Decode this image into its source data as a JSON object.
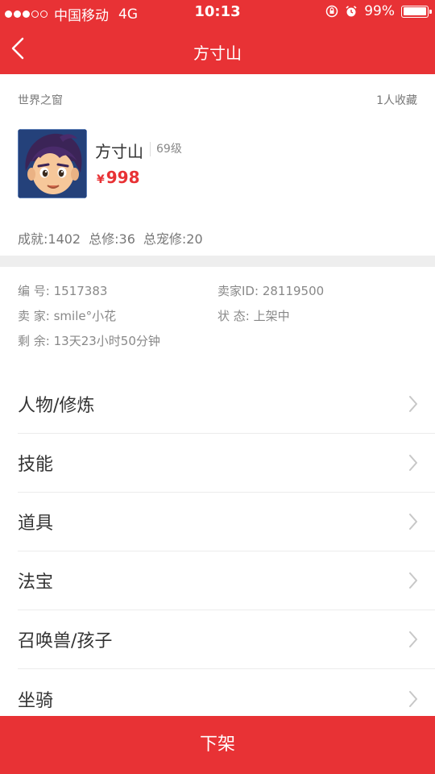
{
  "status_bar": {
    "carrier": "中国移动",
    "network": "4G",
    "time": "10:13",
    "battery": "99%",
    "battery_level": 0.99
  },
  "nav": {
    "title": "方寸山",
    "back_icon": "chevron-left-icon"
  },
  "role": {
    "server": "世界之窗",
    "favorites": "1人收藏",
    "name": "方寸山",
    "level": "69级",
    "price_symbol": "¥",
    "price": "998",
    "stats": [
      "成就:1402",
      "总修:36",
      "总宠修:20"
    ]
  },
  "details": {
    "id_label": "编  号:",
    "id_value": "1517383",
    "seller_id_label": "卖家ID:",
    "seller_id_value": "28119500",
    "seller_label": "卖  家:",
    "seller_value": "smile°小花",
    "status_label": "状  态:",
    "status_value": "上架中",
    "remain_label": "剩  余:",
    "remain_value": "13天23小时50分钟"
  },
  "menu": [
    {
      "label": "人物/修炼"
    },
    {
      "label": "技能"
    },
    {
      "label": "道具"
    },
    {
      "label": "法宝"
    },
    {
      "label": "召唤兽/孩子"
    },
    {
      "label": "坐骑"
    }
  ],
  "footer": {
    "button_label": "下架"
  },
  "colors": {
    "brand": "#e83235",
    "divider": "#eeeeee"
  }
}
